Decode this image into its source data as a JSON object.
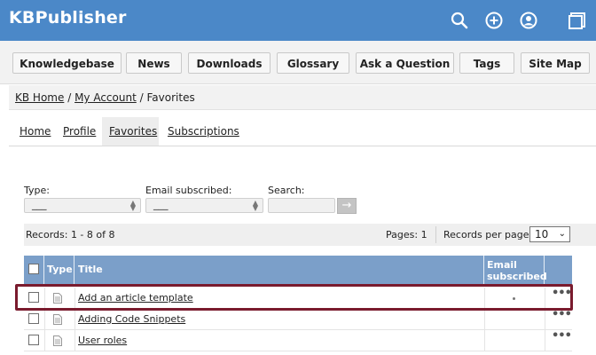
{
  "app": {
    "title": "KBPublisher"
  },
  "header_icons": [
    "search-icon",
    "add-icon",
    "user-icon",
    "window-icon"
  ],
  "nav": [
    {
      "label": "Knowledgebase"
    },
    {
      "label": "News"
    },
    {
      "label": "Downloads"
    },
    {
      "label": "Glossary"
    },
    {
      "label": "Ask a Question"
    },
    {
      "label": "Tags"
    },
    {
      "label": "Site Map"
    }
  ],
  "breadcrumb": {
    "home": "KB Home",
    "sep1": "/",
    "account": "My Account",
    "sep2": "/",
    "current": "Favorites"
  },
  "tabs": [
    {
      "label": "Home"
    },
    {
      "label": "Profile"
    },
    {
      "label": "Favorites",
      "active": true
    },
    {
      "label": "Subscriptions"
    }
  ],
  "filters": {
    "type_label": "Type:",
    "type_value": "___",
    "email_label": "Email subscribed:",
    "email_value": "___",
    "search_label": "Search:",
    "search_value": "",
    "go_label": "→"
  },
  "records": {
    "summary": "Records: 1 - 8 of 8",
    "pages": "Pages: 1",
    "per_page_label": "Records per page:",
    "per_page_value": "10"
  },
  "table": {
    "headers": {
      "type": "Type",
      "title": "Title",
      "email_line1": "Email",
      "email_line2": "subscribed"
    },
    "rows": [
      {
        "title": "Add an article template",
        "more": "•••"
      },
      {
        "title": "Adding Code Snippets",
        "more": "•••"
      },
      {
        "title": "User roles",
        "more": "•••"
      }
    ]
  },
  "colors": {
    "header_bg": "#4b88c8",
    "table_header_bg": "#7b9fc9",
    "highlight_border": "#7a1b2e"
  }
}
